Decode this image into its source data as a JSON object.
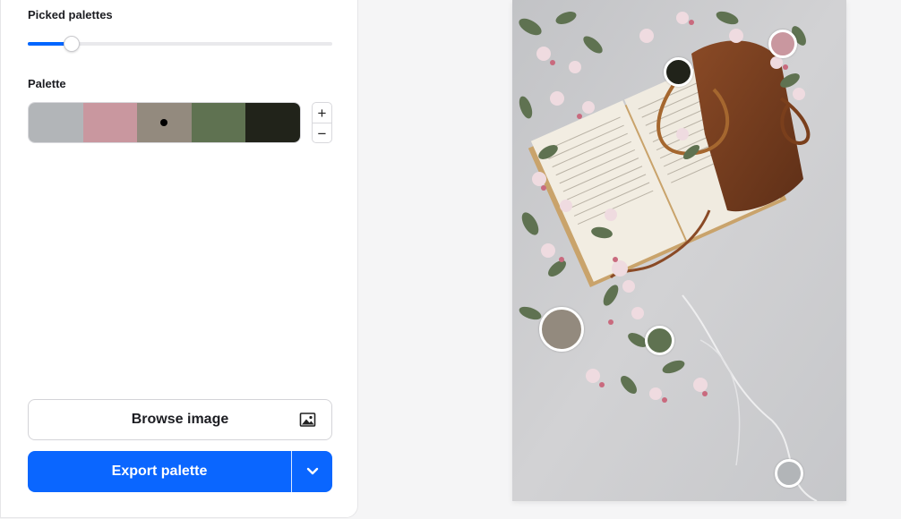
{
  "sidebar": {
    "picked_palettes_label": "Picked palettes",
    "slider_value_fraction": 0.145,
    "palette_label": "Palette",
    "palette": [
      "#b2b5b8",
      "#c9979f",
      "#938a7e",
      "#5f7251",
      "#21231a"
    ],
    "selected_swatch_index": 2,
    "stepper": {
      "plus": "+",
      "minus": "−"
    },
    "browse_label": "Browse image",
    "export_label": "Export palette"
  },
  "colors": {
    "accent": "#0a66ff",
    "panel_bg": "#ffffff",
    "page_bg": "#f5f5f6"
  },
  "image": {
    "description_icon": "image-icon",
    "pickers": [
      {
        "name": "picker-pink",
        "color": "#c9979f"
      },
      {
        "name": "picker-dark",
        "color": "#21231a"
      },
      {
        "name": "picker-taupe",
        "color": "#938a7e"
      },
      {
        "name": "picker-green",
        "color": "#5f7251"
      },
      {
        "name": "picker-grey",
        "color": "#b2b5b8"
      }
    ]
  }
}
